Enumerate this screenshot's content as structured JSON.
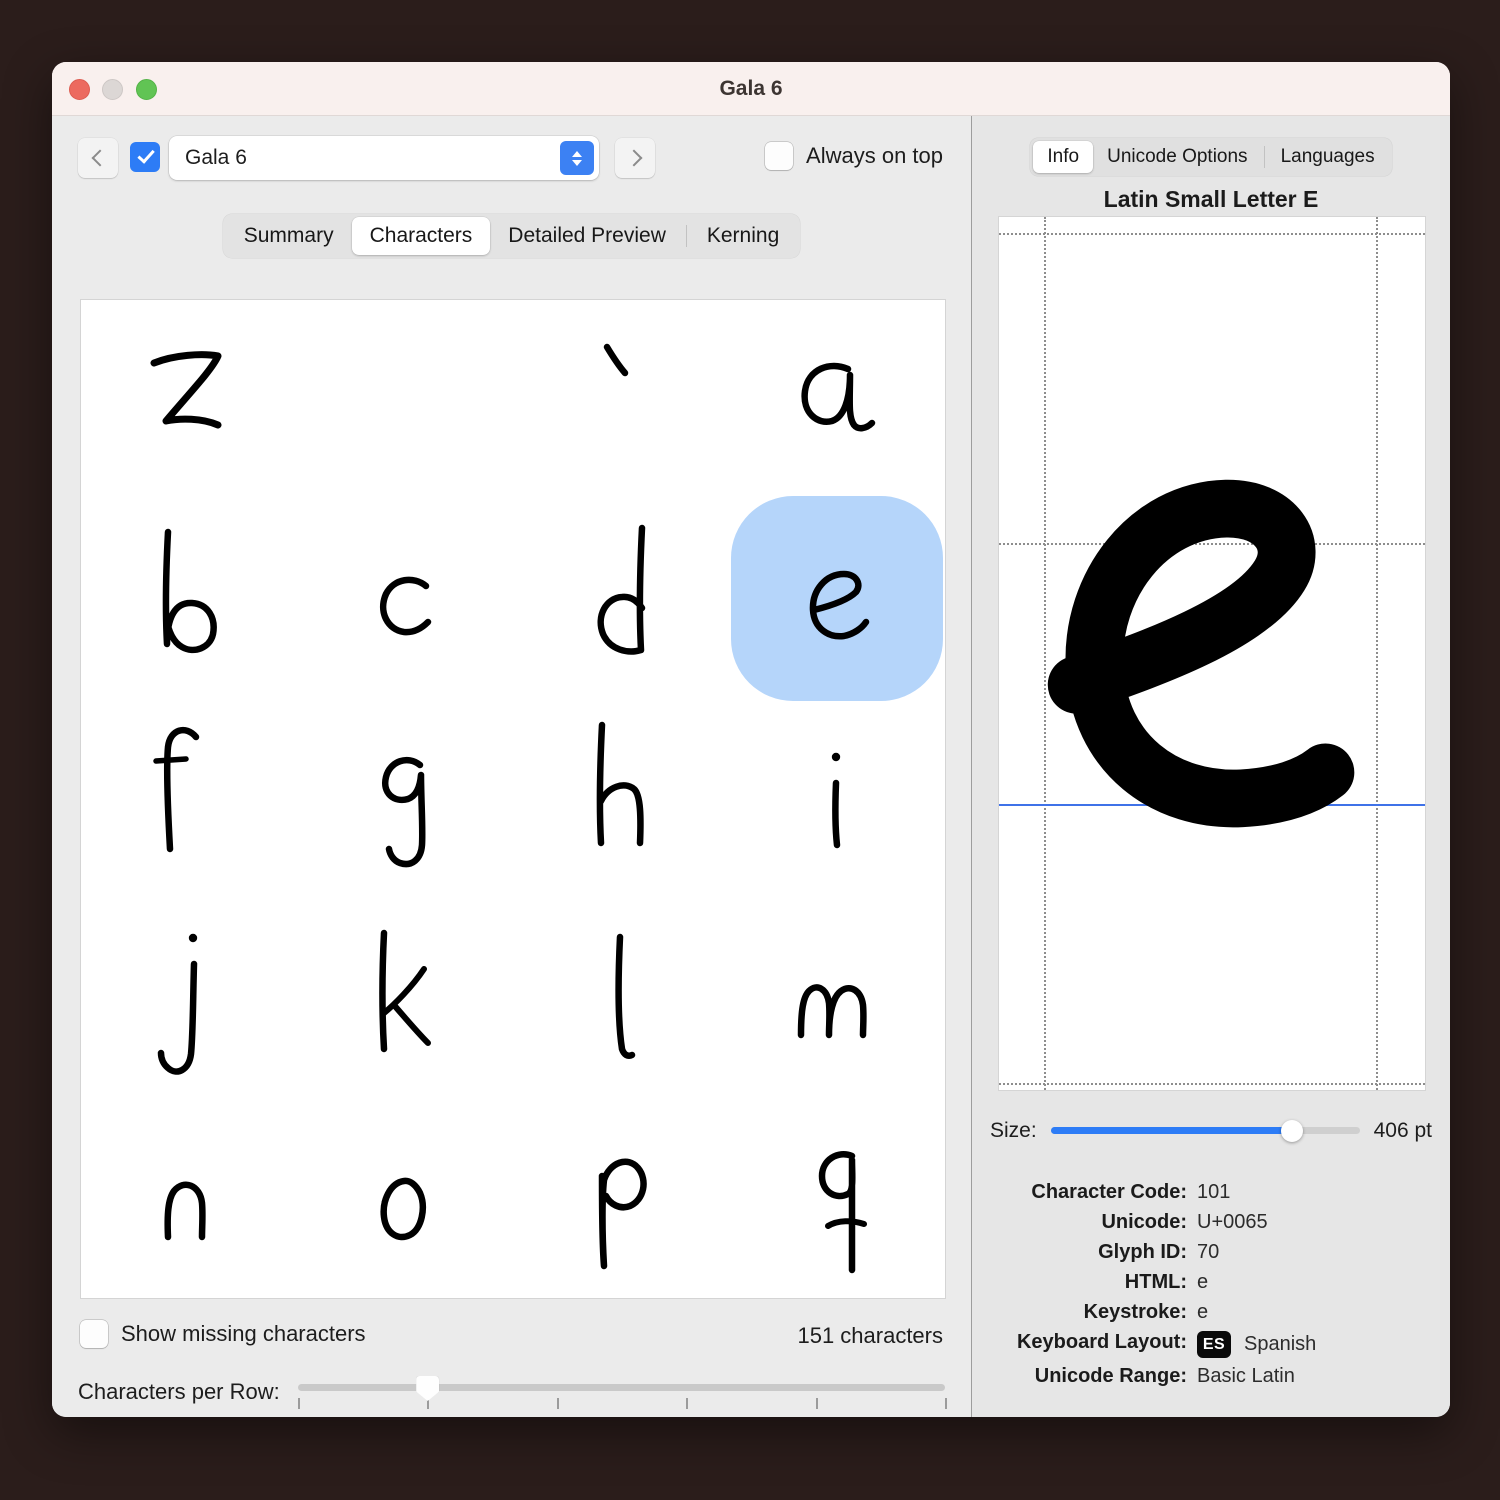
{
  "window": {
    "title": "Gala 6",
    "traffic_lights": [
      "close",
      "minimize",
      "maximize"
    ]
  },
  "toolbar": {
    "prev_label": "‹",
    "next_label": "›",
    "font_checkbox_checked": true,
    "font_value": "Gala 6",
    "always_on_top_label": "Always on top",
    "always_on_top_checked": false
  },
  "tabs": {
    "items": [
      "Summary",
      "Characters",
      "Detailed Preview",
      "Kerning"
    ],
    "active": "Characters"
  },
  "grid": {
    "rows": [
      [
        {
          "char": "z",
          "selected": false
        },
        {
          "char": "",
          "selected": false
        },
        {
          "char": "`",
          "selected": false
        },
        {
          "char": "a",
          "selected": false
        }
      ],
      [
        {
          "char": "b",
          "selected": false
        },
        {
          "char": "c",
          "selected": false
        },
        {
          "char": "d",
          "selected": false
        },
        {
          "char": "e",
          "selected": true
        }
      ],
      [
        {
          "char": "f",
          "selected": false
        },
        {
          "char": "g",
          "selected": false
        },
        {
          "char": "h",
          "selected": false
        },
        {
          "char": "i",
          "selected": false
        }
      ],
      [
        {
          "char": "j",
          "selected": false
        },
        {
          "char": "k",
          "selected": false
        },
        {
          "char": "l",
          "selected": false
        },
        {
          "char": "m",
          "selected": false
        }
      ],
      [
        {
          "char": "n",
          "selected": false
        },
        {
          "char": "o",
          "selected": false
        },
        {
          "char": "p",
          "selected": false
        },
        {
          "char": "q",
          "selected": false
        }
      ]
    ]
  },
  "footer": {
    "show_missing_label": "Show missing characters",
    "show_missing_checked": false,
    "character_count": "151 characters",
    "chars_per_row_label": "Characters per Row:",
    "chars_per_row_percent": 20,
    "chars_per_row_ticks": 6
  },
  "inspector": {
    "tabs": [
      "Info",
      "Unicode Options",
      "Languages"
    ],
    "active_tab": "Info",
    "glyph_name": "Latin Small Letter E",
    "size": {
      "label": "Size:",
      "value": "406 pt",
      "percent": 78
    },
    "info": [
      {
        "key": "Character Code:",
        "value": "101"
      },
      {
        "key": "Unicode:",
        "value": "U+0065"
      },
      {
        "key": "Glyph ID:",
        "value": "70"
      },
      {
        "key": "HTML:",
        "value": "e"
      },
      {
        "key": "Keystroke:",
        "value": "e"
      },
      {
        "key": "Keyboard Layout:",
        "value": "Spanish",
        "badge": "ES"
      },
      {
        "key": "Unicode Range:",
        "value": "Basic Latin"
      }
    ]
  },
  "colors": {
    "accent": "#2d7cf6",
    "selection": "#b5d5fa",
    "baseline": "#3f72e8",
    "titlebar": "#f9f0ee",
    "desktop": "#2b1d1b"
  }
}
